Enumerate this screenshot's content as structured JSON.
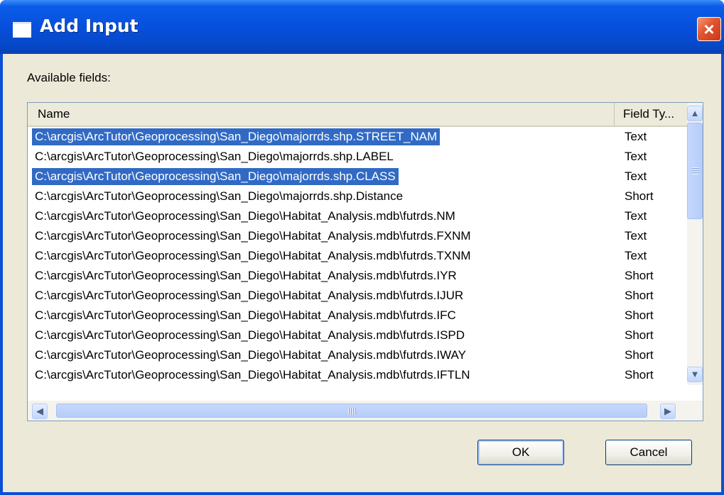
{
  "dialog": {
    "title": "Add Input",
    "close_icon": "×",
    "available_label": "Available fields:",
    "ok_label": "OK",
    "cancel_label": "Cancel"
  },
  "list": {
    "columns": [
      "Name",
      "Field Ty..."
    ],
    "rows": [
      {
        "name": "C:\\arcgis\\ArcTutor\\Geoprocessing\\San_Diego\\majorrds.shp.STREET_NAM",
        "type": "Text",
        "selected": true
      },
      {
        "name": "C:\\arcgis\\ArcTutor\\Geoprocessing\\San_Diego\\majorrds.shp.LABEL",
        "type": "Text",
        "selected": false
      },
      {
        "name": "C:\\arcgis\\ArcTutor\\Geoprocessing\\San_Diego\\majorrds.shp.CLASS",
        "type": "Text",
        "selected": true
      },
      {
        "name": "C:\\arcgis\\ArcTutor\\Geoprocessing\\San_Diego\\majorrds.shp.Distance",
        "type": "Short",
        "selected": false
      },
      {
        "name": "C:\\arcgis\\ArcTutor\\Geoprocessing\\San_Diego\\Habitat_Analysis.mdb\\futrds.NM",
        "type": "Text",
        "selected": false
      },
      {
        "name": "C:\\arcgis\\ArcTutor\\Geoprocessing\\San_Diego\\Habitat_Analysis.mdb\\futrds.FXNM",
        "type": "Text",
        "selected": false
      },
      {
        "name": "C:\\arcgis\\ArcTutor\\Geoprocessing\\San_Diego\\Habitat_Analysis.mdb\\futrds.TXNM",
        "type": "Text",
        "selected": false
      },
      {
        "name": "C:\\arcgis\\ArcTutor\\Geoprocessing\\San_Diego\\Habitat_Analysis.mdb\\futrds.IYR",
        "type": "Short",
        "selected": false
      },
      {
        "name": "C:\\arcgis\\ArcTutor\\Geoprocessing\\San_Diego\\Habitat_Analysis.mdb\\futrds.IJUR",
        "type": "Short",
        "selected": false
      },
      {
        "name": "C:\\arcgis\\ArcTutor\\Geoprocessing\\San_Diego\\Habitat_Analysis.mdb\\futrds.IFC",
        "type": "Short",
        "selected": false
      },
      {
        "name": "C:\\arcgis\\ArcTutor\\Geoprocessing\\San_Diego\\Habitat_Analysis.mdb\\futrds.ISPD",
        "type": "Short",
        "selected": false
      },
      {
        "name": "C:\\arcgis\\ArcTutor\\Geoprocessing\\San_Diego\\Habitat_Analysis.mdb\\futrds.IWAY",
        "type": "Short",
        "selected": false
      },
      {
        "name": "C:\\arcgis\\ArcTutor\\Geoprocessing\\San_Diego\\Habitat_Analysis.mdb\\futrds.IFTLN",
        "type": "Short",
        "selected": false
      }
    ]
  },
  "scroll": {
    "up_arrow": "▲",
    "down_arrow": "▼",
    "left_arrow": "◀",
    "right_arrow": "▶"
  },
  "colors": {
    "title_bar": "#0650dc",
    "selection": "#316ac5",
    "dialog_face": "#ece9d8"
  }
}
